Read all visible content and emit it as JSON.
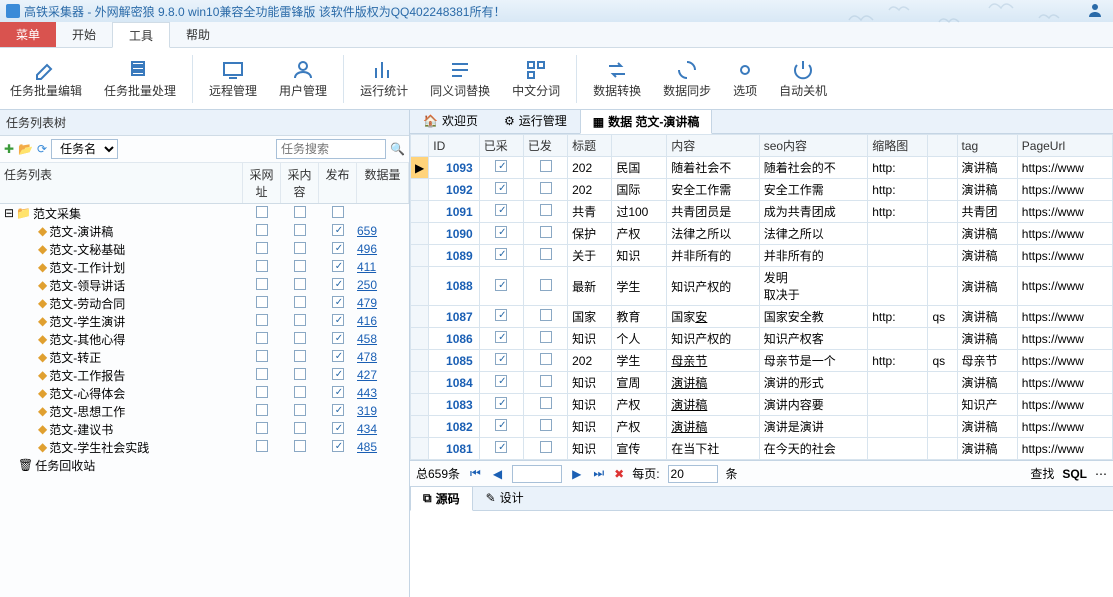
{
  "app": {
    "title": "高铁采集器 - 外网解密狼 9.8.0 win10兼容全功能雷锋版  该软件版权为QQ402248381所有！"
  },
  "menu": {
    "red": "菜单",
    "items": [
      "开始",
      "工具",
      "帮助"
    ],
    "active": 1
  },
  "ribbon": [
    {
      "label": "任务批量编辑",
      "icon": "edit"
    },
    {
      "label": "任务批量处理",
      "icon": "batch"
    },
    {
      "sep": true
    },
    {
      "label": "远程管理",
      "icon": "remote"
    },
    {
      "label": "用户管理",
      "icon": "user"
    },
    {
      "sep": true
    },
    {
      "label": "运行统计",
      "icon": "stats"
    },
    {
      "label": "同义词替换",
      "icon": "synonym"
    },
    {
      "label": "中文分词",
      "icon": "segment"
    },
    {
      "sep": true
    },
    {
      "label": "数据转换",
      "icon": "convert"
    },
    {
      "label": "数据同步",
      "icon": "sync"
    },
    {
      "label": "选项",
      "icon": "settings"
    },
    {
      "label": "自动关机",
      "icon": "power"
    }
  ],
  "left": {
    "title": "任务列表树",
    "combo": "任务名",
    "search_ph": "任务搜索",
    "cols": {
      "name": "任务列表",
      "c1": "采网址",
      "c2": "采内容",
      "c3": "发布",
      "c4": "数据量"
    },
    "root": "范文采集",
    "items": [
      {
        "name": "范文-演讲稿",
        "pub": true,
        "count": "659"
      },
      {
        "name": "范文-文秘基础",
        "pub": true,
        "count": "496"
      },
      {
        "name": "范文-工作计划",
        "pub": true,
        "count": "411"
      },
      {
        "name": "范文-领导讲话",
        "pub": true,
        "count": "250"
      },
      {
        "name": "范文-劳动合同",
        "pub": true,
        "count": "479"
      },
      {
        "name": "范文-学生演讲",
        "pub": true,
        "count": "416"
      },
      {
        "name": "范文-其他心得",
        "pub": true,
        "count": "458"
      },
      {
        "name": "范文-转正",
        "pub": true,
        "count": "478"
      },
      {
        "name": "范文-工作报告",
        "pub": true,
        "count": "427"
      },
      {
        "name": "范文-心得体会",
        "pub": true,
        "count": "443"
      },
      {
        "name": "范文-思想工作",
        "pub": true,
        "count": "319"
      },
      {
        "name": "范文-建议书",
        "pub": true,
        "count": "434"
      },
      {
        "name": "范文-学生社会实践",
        "pub": true,
        "count": "485"
      }
    ],
    "recycle": "任务回收站"
  },
  "tabs": [
    {
      "label": "欢迎页",
      "icon": "home"
    },
    {
      "label": "运行管理",
      "icon": "run"
    },
    {
      "label": "数据    范文-演讲稿",
      "icon": "data",
      "active": true
    }
  ],
  "grid": {
    "cols": [
      "",
      "ID",
      "已采",
      "已发",
      "标题",
      "",
      "内容",
      "seo内容",
      "缩略图",
      "",
      "tag",
      "PageUrl"
    ],
    "rows": [
      {
        "ptr": true,
        "id": "1093",
        "cai": true,
        "fa": false,
        "c": [
          "202",
          "民国",
          "<p>随着社会不",
          "随着社会的不",
          "http:",
          "",
          "演讲稿",
          "https://www"
        ]
      },
      {
        "id": "1092",
        "cai": true,
        "fa": false,
        "c": [
          "202",
          "国际",
          "<p>安全工作需",
          "安全工作需",
          "http:",
          "",
          "演讲稿",
          "https://www"
        ]
      },
      {
        "id": "1091",
        "cai": true,
        "fa": false,
        "c": [
          "共青",
          "过100",
          "<p>共青团员是",
          "成为共青团成",
          "http:",
          "",
          "共青团",
          "https://www"
        ]
      },
      {
        "id": "1090",
        "cai": true,
        "fa": false,
        "c": [
          "保护",
          "产权",
          "<p>法律之所以",
          "<p>法律之所以",
          "",
          "",
          "演讲稿",
          "https://www"
        ]
      },
      {
        "id": "1089",
        "cai": true,
        "fa": false,
        "c": [
          "关于",
          "知识",
          "<p>并非所有的",
          "<p>并非所有的",
          "",
          "",
          "演讲稿",
          "https://www"
        ]
      },
      {
        "id": "1088",
        "cai": true,
        "fa": false,
        "c": [
          "最新",
          "学生",
          "<p>知识产权的",
          "发明<p>取决于",
          "",
          "",
          "演讲稿",
          "https://www"
        ]
      },
      {
        "id": "1087",
        "cai": true,
        "fa": false,
        "c": [
          "国家",
          "教育",
          "<p>国家<u>安",
          "<p>国家安全教",
          "http:",
          "qs",
          "演讲稿",
          "https://www"
        ]
      },
      {
        "id": "1086",
        "cai": true,
        "fa": false,
        "c": [
          "知识",
          "个人",
          "<p>知识产权的",
          "<p>知识产权客",
          "",
          "",
          "演讲稿",
          "https://www"
        ]
      },
      {
        "id": "1085",
        "cai": true,
        "fa": false,
        "c": [
          "202",
          "学生",
          "<p><u>母亲节",
          "母亲节是一个",
          "http:",
          "qs",
          "母亲节",
          "https://www"
        ]
      },
      {
        "id": "1084",
        "cai": true,
        "fa": false,
        "c": [
          "知识",
          "宣周",
          "<p><u>演讲稿",
          "演讲的形式",
          "",
          "",
          "演讲稿",
          "https://www"
        ]
      },
      {
        "id": "1083",
        "cai": true,
        "fa": false,
        "c": [
          "知识",
          "产权",
          "<p><u>演讲稿",
          "<p>演讲内容要",
          "",
          "",
          "知识产",
          "https://www"
        ]
      },
      {
        "id": "1082",
        "cai": true,
        "fa": false,
        "c": [
          "知识",
          "产权",
          "<p><u>演讲稿",
          "演讲是演讲",
          "",
          "",
          "演讲稿",
          "https://www"
        ]
      },
      {
        "id": "1081",
        "cai": true,
        "fa": false,
        "c": [
          "知识",
          "宣传",
          "<p>在当下社",
          "在今天的社会",
          "",
          "",
          "演讲稿",
          "https://www"
        ]
      }
    ],
    "total": "总659条",
    "per_page_label": "每页:",
    "per_page": "20",
    "unit": "条",
    "find": "查找",
    "sql": "SQL"
  },
  "bottom_tabs": [
    {
      "label": "源码",
      "icon": "code",
      "active": true
    },
    {
      "label": "设计",
      "icon": "design"
    }
  ]
}
